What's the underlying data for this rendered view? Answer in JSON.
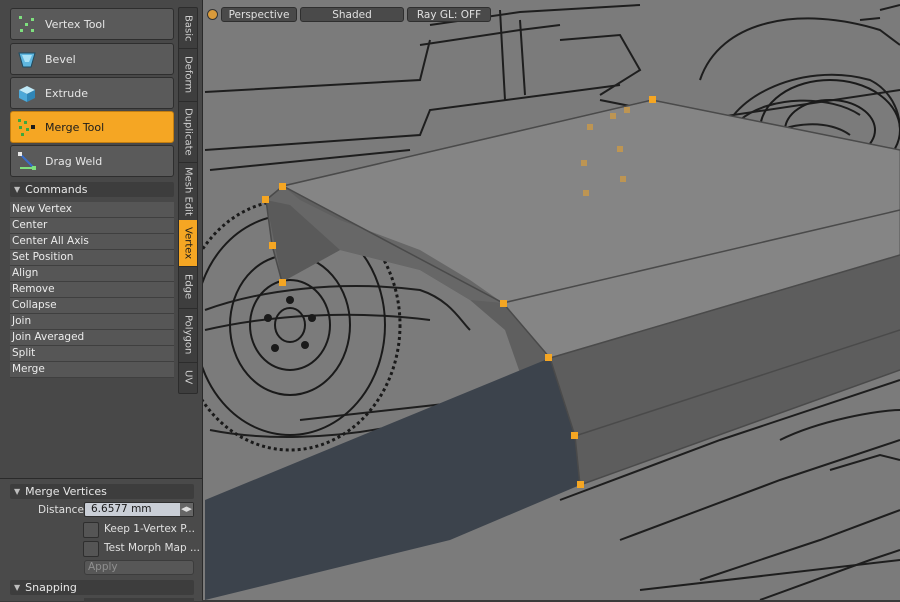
{
  "tools": [
    {
      "label": "Vertex Tool",
      "icon": "vertex-tool-icon",
      "active": false
    },
    {
      "label": "Bevel",
      "icon": "bevel-icon",
      "active": false
    },
    {
      "label": "Extrude",
      "icon": "extrude-icon",
      "active": false
    },
    {
      "label": "Merge Tool",
      "icon": "merge-tool-icon",
      "active": true
    },
    {
      "label": "Drag Weld",
      "icon": "drag-weld-icon",
      "active": false
    }
  ],
  "tabs": [
    {
      "label": "Basic",
      "active": false
    },
    {
      "label": "Deform",
      "active": false
    },
    {
      "label": "Duplicate",
      "active": false
    },
    {
      "label": "Mesh Edit",
      "active": false
    },
    {
      "label": "Vertex",
      "active": true
    },
    {
      "label": "Edge",
      "active": false
    },
    {
      "label": "Polygon",
      "active": false
    },
    {
      "label": "UV",
      "active": false
    }
  ],
  "commands": {
    "header": "Commands",
    "items": [
      "New Vertex",
      "Center",
      "Center All Axis",
      "Set Position",
      "Align",
      "Remove",
      "Collapse",
      "Join",
      "Join Averaged",
      "Split",
      "Merge"
    ]
  },
  "merge_vertices": {
    "header": "Merge Vertices",
    "distance_label": "Distance",
    "distance_value": "6.6577 mm",
    "keep_label": "Keep 1-Vertex P...",
    "morph_label": "Test Morph Map ...",
    "apply_label": "Apply"
  },
  "snapping": {
    "header": "Snapping"
  },
  "viewport": {
    "view_label": "Perspective",
    "shading_label": "Shaded",
    "raygl_label": "Ray GL: OFF"
  },
  "colors": {
    "accent": "#f5a623",
    "panel": "#484848",
    "viewport_bg": "#7b7b7b"
  }
}
